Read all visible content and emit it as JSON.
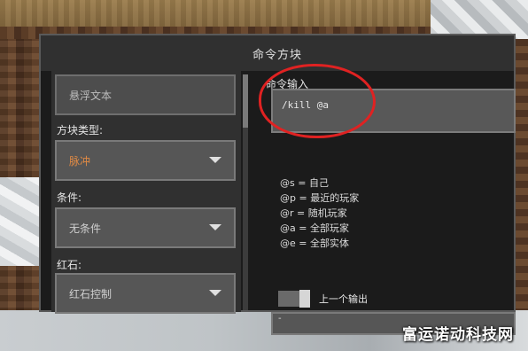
{
  "window": {
    "title": "命令方块"
  },
  "left": {
    "hover_note_placeholder": "悬浮文本",
    "block_type": {
      "label": "方块类型:",
      "value": "脉冲"
    },
    "condition": {
      "label": "条件:",
      "value": "无条件"
    },
    "redstone": {
      "label": "红石:",
      "value": "红石控制"
    }
  },
  "command": {
    "label": "命令输入",
    "value": "/kill @a"
  },
  "selectors": [
    "@s = 自己",
    "@p = 最近的玩家",
    "@r = 随机玩家",
    "@a = 全部玩家",
    "@e = 全部实体"
  ],
  "output": {
    "toggle_label": "上一个输出",
    "value": "-"
  },
  "watermark": "富运诺动科技网",
  "colors": {
    "annotation_circle": "#e02222",
    "pulse_text": "#e08a44"
  }
}
